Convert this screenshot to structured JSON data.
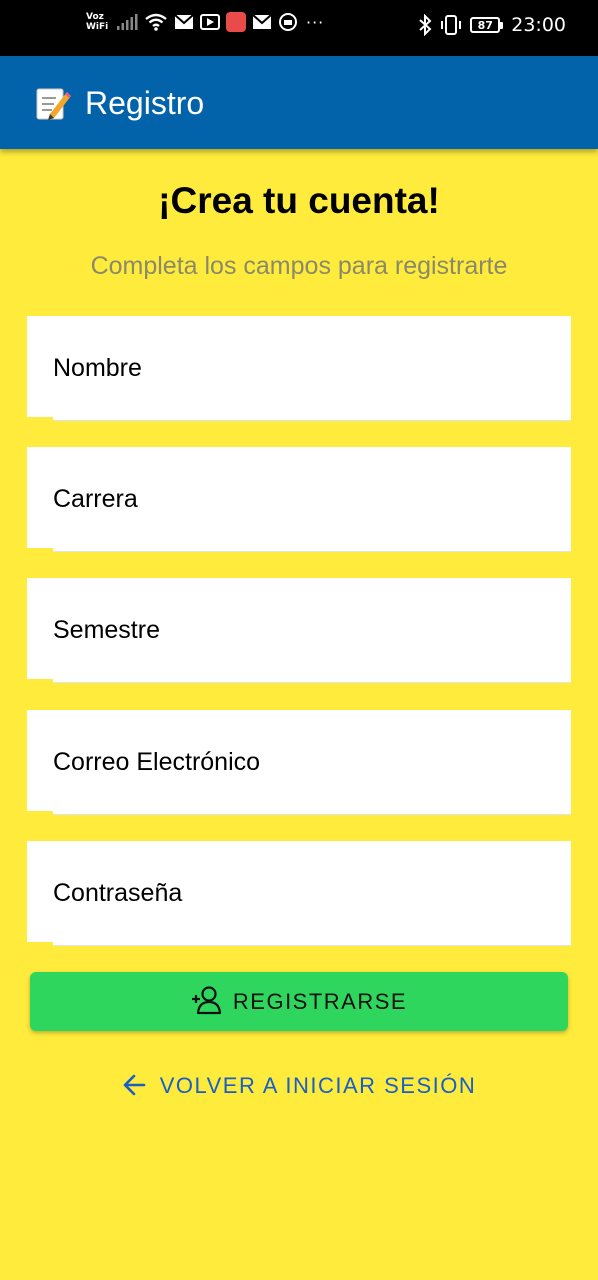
{
  "status_bar": {
    "network_label_line1": "Voz",
    "network_label_line2": "WiFi",
    "time": "23:00",
    "battery": "87",
    "more": "···"
  },
  "app_bar": {
    "title": "Registro",
    "icon": "memo-pencil-icon"
  },
  "header": {
    "title": "¡Crea tu cuenta!",
    "subtitle": "Completa los campos para registrarte"
  },
  "form": {
    "fields": [
      {
        "placeholder": "Nombre",
        "value": ""
      },
      {
        "placeholder": "Carrera",
        "value": ""
      },
      {
        "placeholder": "Semestre",
        "value": ""
      },
      {
        "placeholder": "Correo Electrónico",
        "value": ""
      },
      {
        "placeholder": "Contraseña",
        "value": ""
      }
    ],
    "register_label": "REGISTRARSE",
    "register_icon": "add-user-icon",
    "back_label": "VOLVER A INICIAR SESIÓN",
    "back_icon": "arrow-left-icon"
  },
  "colors": {
    "background": "#FFEB3B",
    "app_bar": "#0263AB",
    "register_button": "#2ED65E",
    "link": "#1A5FC7",
    "subtitle": "#8A8A6A"
  }
}
